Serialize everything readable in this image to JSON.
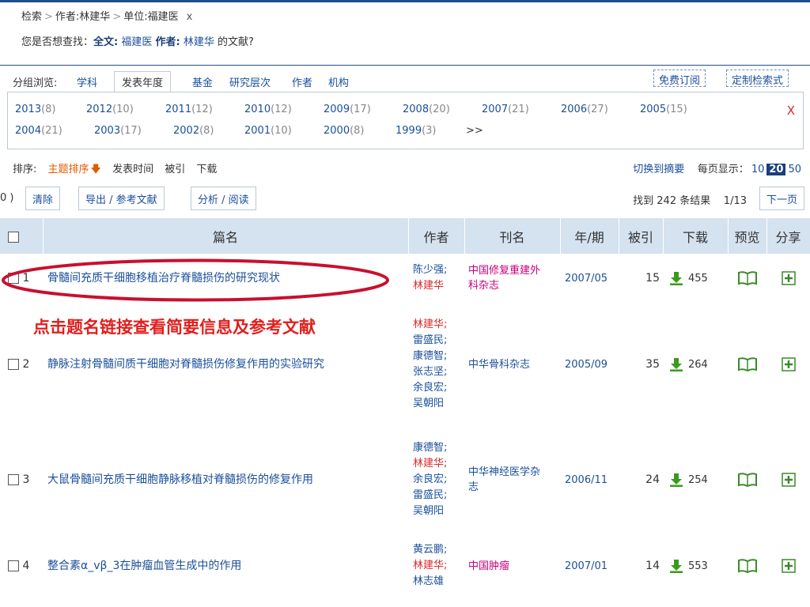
{
  "breadcrumb": {
    "root": "检索",
    "author_filter": "作者:林建华",
    "unit_filter": "单位:福建医",
    "clear": "x"
  },
  "suggest": {
    "prefix": "您是否想查找：",
    "fulltext_label": "全文:",
    "fulltext_value": "福建医",
    "author_label": "作者:",
    "author_value": "林建华",
    "suffix": "的文献?"
  },
  "group_browse": {
    "label": "分组浏览:",
    "tabs": [
      "学科",
      "发表年度",
      "基金",
      "研究层次",
      "作者",
      "机构"
    ],
    "active_tab": "发表年度",
    "free_subscribe": "免费订阅",
    "custom_query": "定制检索式"
  },
  "years": {
    "row1": [
      {
        "year": "2013",
        "count": "(8)"
      },
      {
        "year": "2012",
        "count": "(10)"
      },
      {
        "year": "2011",
        "count": "(12)"
      },
      {
        "year": "2010",
        "count": "(12)"
      },
      {
        "year": "2009",
        "count": "(17)"
      },
      {
        "year": "2008",
        "count": "(20)"
      },
      {
        "year": "2007",
        "count": "(21)"
      },
      {
        "year": "2006",
        "count": "(27)"
      },
      {
        "year": "2005",
        "count": "(15)"
      }
    ],
    "row2": [
      {
        "year": "2004",
        "count": "(21)"
      },
      {
        "year": "2003",
        "count": "(17)"
      },
      {
        "year": "2002",
        "count": "(8)"
      },
      {
        "year": "2001",
        "count": "(10)"
      },
      {
        "year": "2000",
        "count": "(8)"
      },
      {
        "year": "1999",
        "count": "(3)"
      }
    ],
    "more": ">>",
    "close": "X"
  },
  "sort": {
    "label": "排序:",
    "options": [
      "主题排序",
      "发表时间",
      "被引",
      "下载"
    ],
    "active": "主题排序",
    "arrow": "🡇",
    "switch_summary": "切换到摘要",
    "per_page_label": "每页显示：",
    "per_page_options": [
      "10",
      "20",
      "50"
    ],
    "per_page_current": "20"
  },
  "actions": {
    "selected_suffix": "0 )",
    "clear": "清除",
    "export": "导出 / 参考文献",
    "analyze": "分析 / 阅读",
    "found_prefix": "找到",
    "found_count": "242",
    "found_suffix": "条结果",
    "page_indicator": "1/13",
    "next_page": "下一页"
  },
  "table": {
    "headers": [
      "篇名",
      "作者",
      "刊名",
      "年/期",
      "被引",
      "下载",
      "预览",
      "分享"
    ],
    "rows": [
      {
        "no": "1",
        "title": "骨髓间充质干细胞移植治疗脊髓损伤的研究现状",
        "authors": [
          {
            "name": "陈少强;",
            "hl": false
          },
          {
            "name": "林建华",
            "hl": true
          }
        ],
        "journal": "中国修复重建外科杂志",
        "journal_red": true,
        "issue": "2007/05",
        "cited": "15",
        "downloads": "455"
      },
      {
        "no": "2",
        "title": "静脉注射骨髓间质干细胞对脊髓损伤修复作用的实验研究",
        "authors": [
          {
            "name": "林建华;",
            "hl": true
          },
          {
            "name": "雷盛民;",
            "hl": false
          },
          {
            "name": "康德智;",
            "hl": false
          },
          {
            "name": "张志坚;",
            "hl": false
          },
          {
            "name": "余良宏;",
            "hl": false
          },
          {
            "name": "吴朝阳",
            "hl": false
          }
        ],
        "journal": "中华骨科杂志",
        "journal_red": false,
        "issue": "2005/09",
        "cited": "35",
        "downloads": "264"
      },
      {
        "no": "3",
        "title": "大鼠骨髓间充质干细胞静脉移植对脊髓损伤的修复作用",
        "authors": [
          {
            "name": "康德智;",
            "hl": false
          },
          {
            "name": "林建华;",
            "hl": true
          },
          {
            "name": "余良宏;",
            "hl": false
          },
          {
            "name": "雷盛民;",
            "hl": false
          },
          {
            "name": "吴朝阳",
            "hl": false
          }
        ],
        "journal": "中华神经医学杂志",
        "journal_red": false,
        "issue": "2006/11",
        "cited": "24",
        "downloads": "254"
      },
      {
        "no": "4",
        "title": "整合素α_vβ_3在肿瘤血管生成中的作用",
        "authors": [
          {
            "name": "黄云鹏;",
            "hl": false
          },
          {
            "name": "林建华;",
            "hl": true
          },
          {
            "name": "林志雄",
            "hl": false
          }
        ],
        "journal": "中国肿瘤",
        "journal_red": true,
        "issue": "2007/01",
        "cited": "14",
        "downloads": "553"
      }
    ]
  },
  "annotation": {
    "text": "点击题名链接查看简要信息及参考文献"
  },
  "colors": {
    "link": "#1a4f9a",
    "author_highlight": "#d62b2b",
    "journal_magenta": "#c8007a",
    "header_bg": "#d5e2f0",
    "annotation_red": "#e0201e",
    "download_green": "#3a9a1c"
  },
  "icons": {
    "download": "download-arrow-icon",
    "preview": "open-book-icon",
    "share": "plus-box-icon",
    "sort_arrow": "down-arrow-icon"
  }
}
